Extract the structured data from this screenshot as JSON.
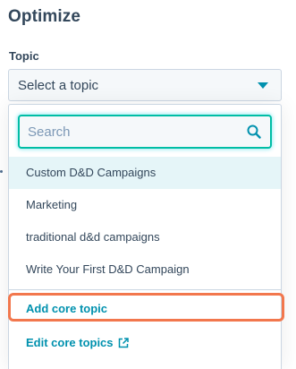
{
  "section": {
    "title": "Optimize"
  },
  "topic_field": {
    "label": "Topic",
    "selected_value": "Select a topic"
  },
  "dropdown": {
    "search": {
      "value": "",
      "placeholder": "Search"
    },
    "options": [
      {
        "label": "Custom D&D Campaigns",
        "highlighted": true
      },
      {
        "label": "Marketing",
        "highlighted": false
      },
      {
        "label": "traditional d&d campaigns",
        "highlighted": false
      },
      {
        "label": "Write Your First D&D Campaign",
        "highlighted": false
      }
    ],
    "add_core_topic_label": "Add core topic",
    "edit_core_topics_label": "Edit core topics"
  },
  "colors": {
    "accent": "#0091ae",
    "focus_border": "#00bda5",
    "highlight_ring": "#f2774d",
    "option_hover": "#e5f5f8",
    "text": "#33475b"
  },
  "icons": {
    "search": "search-icon",
    "caret": "caret-down-icon",
    "external_link": "external-link-icon"
  }
}
